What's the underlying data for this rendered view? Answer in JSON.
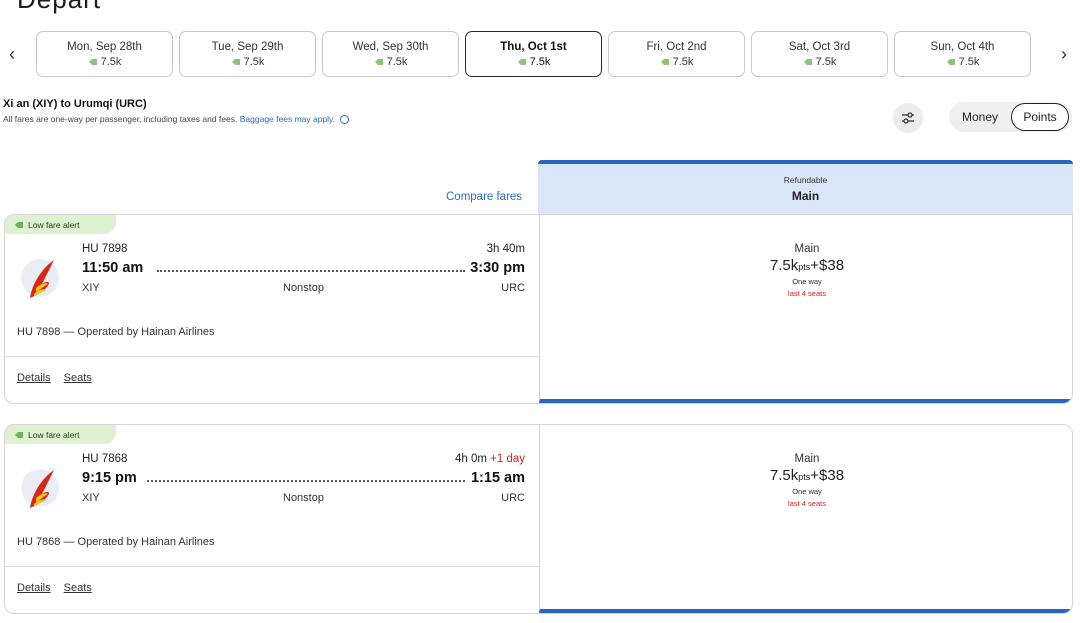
{
  "page": {
    "heading_partial": "Depart"
  },
  "dates": [
    {
      "label": "Mon, Sep 28th",
      "price": "7.5k",
      "selected": false
    },
    {
      "label": "Tue, Sep 29th",
      "price": "7.5k",
      "selected": false
    },
    {
      "label": "Wed, Sep 30th",
      "price": "7.5k",
      "selected": false
    },
    {
      "label": "Thu, Oct 1st",
      "price": "7.5k",
      "selected": true
    },
    {
      "label": "Fri, Oct 2nd",
      "price": "7.5k",
      "selected": false
    },
    {
      "label": "Sat, Oct 3rd",
      "price": "7.5k",
      "selected": false
    },
    {
      "label": "Sun, Oct 4th",
      "price": "7.5k",
      "selected": false
    }
  ],
  "nav": {
    "prev": "‹",
    "next": "›"
  },
  "route": {
    "title": "Xi an (XIY) to Urumqi (URC)",
    "subtitle": "All fares are one-way per passenger, including taxes and fees.",
    "baggage_link": "Baggage fees may apply."
  },
  "toggle": {
    "money": "Money",
    "points": "Points",
    "active": "points"
  },
  "compare_fares": "Compare fares",
  "fare_header": {
    "small": "Refundable",
    "main": "Main"
  },
  "flights": [
    {
      "alert": "Low fare alert",
      "flight_no": "HU 7898",
      "duration": "3h 40m",
      "next_day": "",
      "dep_time": "11:50 am",
      "arr_time": "3:30 pm",
      "dep_code": "XIY",
      "arr_code": "URC",
      "stops": "Nonstop",
      "operated": "HU 7898 — Operated by Hainan Airlines",
      "details": "Details",
      "seats": "Seats",
      "fare": {
        "name": "Main",
        "points": "7.5k",
        "pts_unit": "pts",
        "plus_cash": "+$38",
        "oneway": "One way",
        "seats_left": "last 4 seats"
      }
    },
    {
      "alert": "Low fare alert",
      "flight_no": "HU 7868",
      "duration": "4h 0m",
      "next_day": "+1 day",
      "dep_time": "9:15 pm",
      "arr_time": "1:15 am",
      "dep_code": "XIY",
      "arr_code": "URC",
      "stops": "Nonstop",
      "operated": "HU 7868 — Operated by Hainan Airlines",
      "details": "Details",
      "seats": "Seats",
      "fare": {
        "name": "Main",
        "points": "7.5k",
        "pts_unit": "pts",
        "plus_cash": "+$38",
        "oneway": "One way",
        "seats_left": "last 4 seats"
      }
    }
  ],
  "colors": {
    "accent_blue": "#2b66bd",
    "link_blue": "#2a6bc0",
    "alert_green": "#dff1d3",
    "warning_red": "#d11f1f",
    "fare_header_bg": "#d9e6f7"
  },
  "icons": {
    "filter": "sliders-icon",
    "tag": "tag-icon",
    "info": "info-icon",
    "airline_logo": "hainan-airlines-logo"
  }
}
